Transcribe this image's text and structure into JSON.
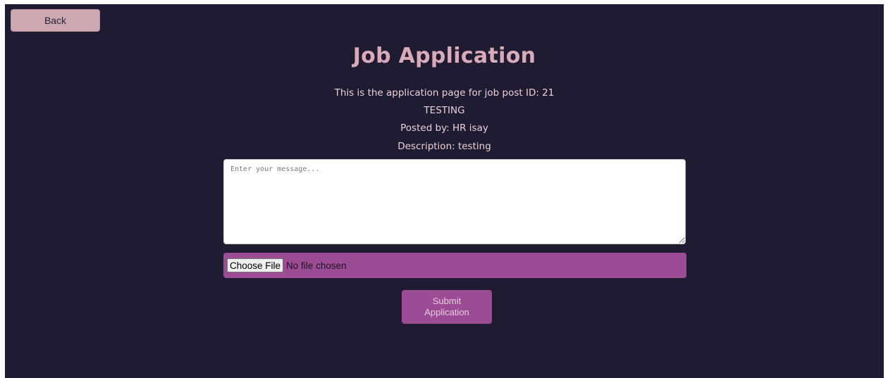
{
  "header": {
    "back_label": "Back",
    "title": "Job Application"
  },
  "job": {
    "id_line": "This is the application page for job post ID: 21",
    "job_title": "TESTING",
    "posted_by": "Posted by: HR isay",
    "description": "Description: testing"
  },
  "form": {
    "message_value": "",
    "message_placeholder": "Enter your message...",
    "file_button_label": "Choose File",
    "file_status": "No file chosen",
    "submit_line1": "Submit",
    "submit_line2": "Application"
  },
  "colors": {
    "background": "#1f1b33",
    "back_button": "#cda8b1",
    "title": "#d9aab7",
    "accent": "#9c4c95"
  }
}
